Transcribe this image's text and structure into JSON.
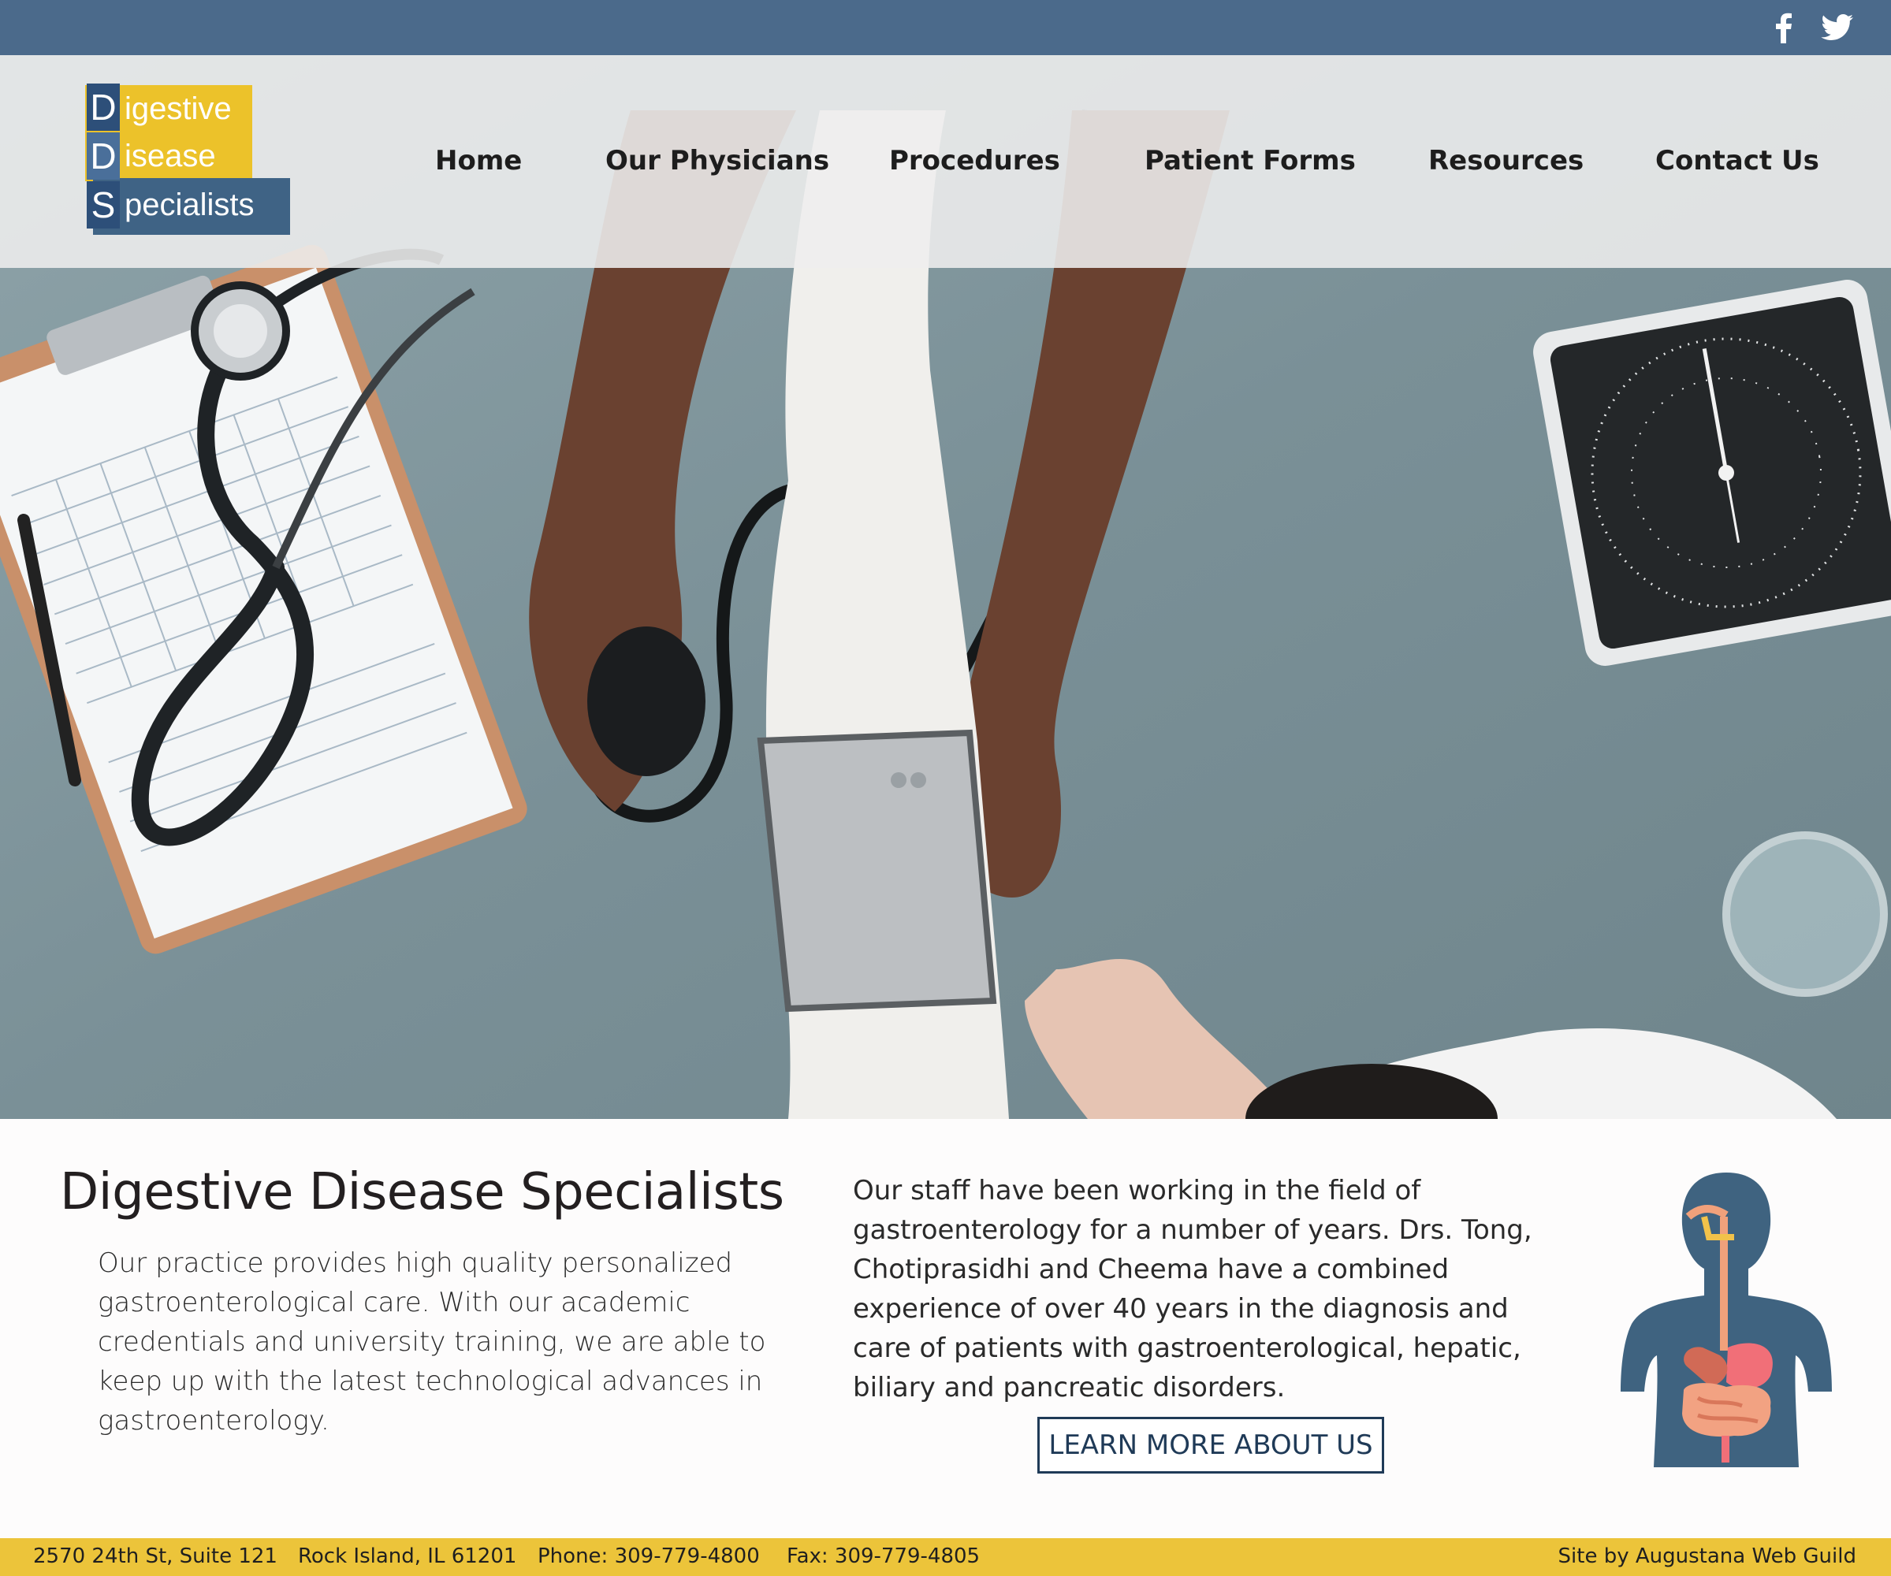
{
  "social": {
    "facebook_icon": "facebook-icon",
    "twitter_icon": "twitter-icon"
  },
  "logo": {
    "letters": [
      "D",
      "D",
      "S"
    ],
    "words": [
      "igestive",
      "isease",
      "pecialists"
    ]
  },
  "nav": {
    "items": [
      "Home",
      "Our Physicians",
      "Procedures",
      "Patient Forms",
      "Resources",
      "Contact Us"
    ]
  },
  "main": {
    "title": "Digestive Disease Specialists",
    "intro": "Our practice provides high quality personalized gastroenterological care. With our academic credentials and university training, we are able to keep up with the latest technological advances in gastroenterology.",
    "staff": "Our staff have been working in the field of gastroenterology for a number of years. Drs. Tong, Chotiprasidhi and Cheema have a combined experience of over 40 years in the diagnosis and care of patients with gastroenterological, hepatic, biliary and pancreatic disorders.",
    "button_label": "LEARN MORE ABOUT US"
  },
  "footer": {
    "address": "2570 24th St, Suite 121",
    "city": "Rock Island, IL 61201",
    "phone": "Phone: 309-779-4800",
    "fax": "Fax: 309-779-4805",
    "credit": "Site by Augustana Web Guild"
  },
  "colors": {
    "topbar": "#4b6a8b",
    "logo_yellow": "#ecc22a",
    "logo_blue": "#3f6385",
    "footer": "#ecc43a",
    "button_border": "#1f3a57"
  }
}
